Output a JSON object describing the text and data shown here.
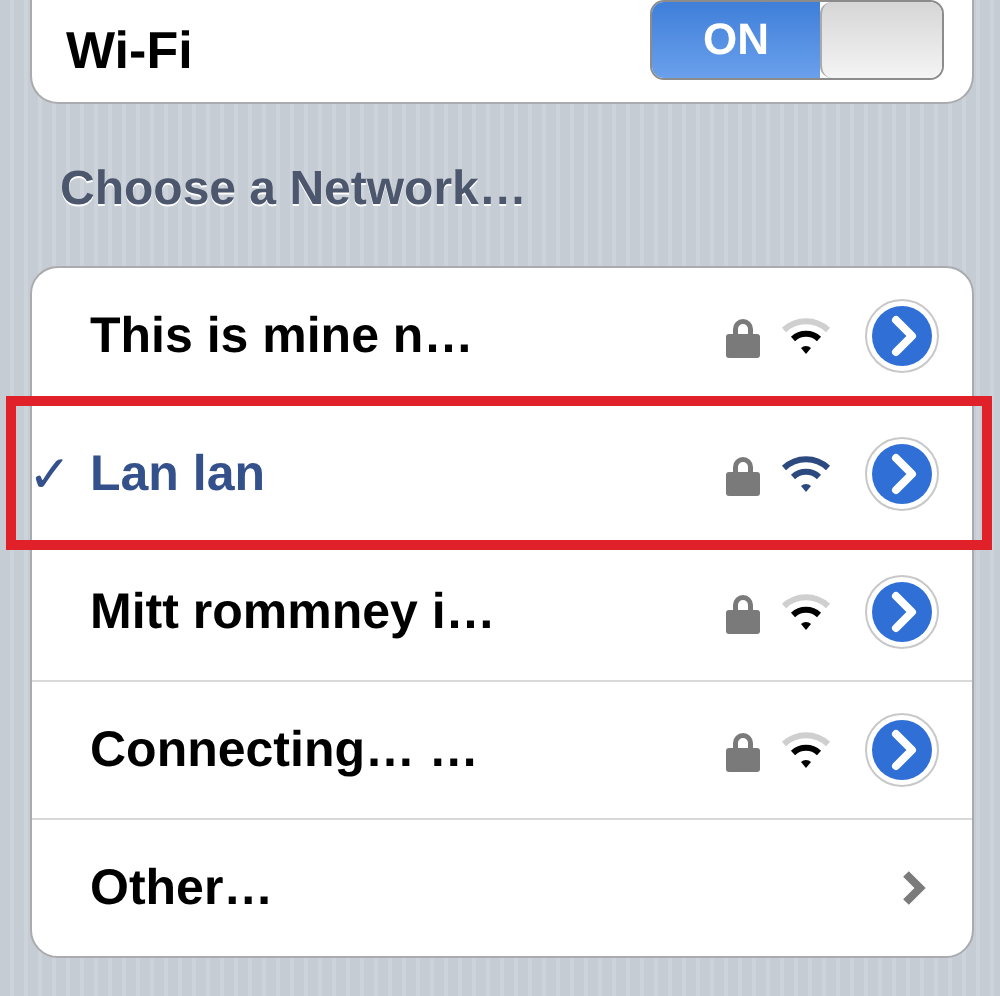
{
  "wifi": {
    "label": "Wi-Fi",
    "switch": {
      "on": true,
      "text": "ON"
    }
  },
  "section_header": "Choose a Network…",
  "networks": [
    {
      "name": "This is mine n…",
      "secured": true,
      "selected": false,
      "highlighted": false
    },
    {
      "name": "Lan lan",
      "secured": true,
      "selected": true,
      "highlighted": true
    },
    {
      "name": "Mitt rommney i…",
      "secured": true,
      "selected": false,
      "highlighted": false
    },
    {
      "name": "Connecting… …",
      "secured": true,
      "selected": false,
      "highlighted": false
    }
  ],
  "other": {
    "label": "Other…"
  },
  "checkmark": "✓"
}
